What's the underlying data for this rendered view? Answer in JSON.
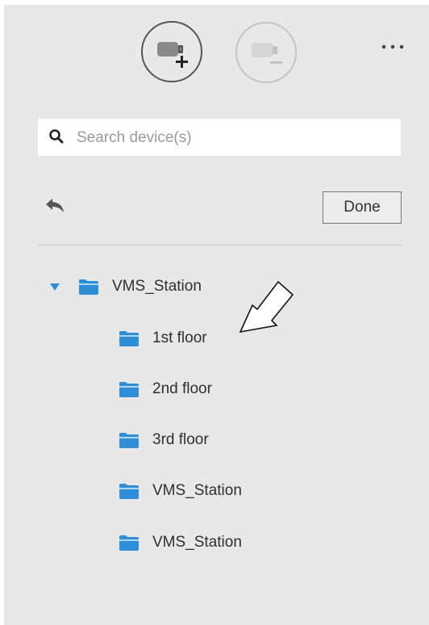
{
  "toolbar": {
    "add_device_icon": "camera-add-icon",
    "remove_device_icon": "camera-remove-icon",
    "more_icon": "more-horizontal-icon"
  },
  "search": {
    "placeholder": "Search device(s)",
    "value": ""
  },
  "actions": {
    "back_icon": "reply-arrow-icon",
    "done_label": "Done"
  },
  "tree": {
    "root": {
      "label": "VMS_Station",
      "expanded": true,
      "icon": "folder-icon"
    },
    "children": [
      {
        "label": "1st floor",
        "icon": "folder-icon"
      },
      {
        "label": "2nd floor",
        "icon": "folder-icon"
      },
      {
        "label": "3rd floor",
        "icon": "folder-icon"
      },
      {
        "label": "VMS_Station",
        "icon": "folder-icon"
      },
      {
        "label": "VMS_Station",
        "icon": "folder-icon"
      }
    ]
  },
  "colors": {
    "panel_bg": "#e8e8e8",
    "folder": "#2e8fd6",
    "caret": "#2e8fd6",
    "text": "#2f2f2f"
  }
}
